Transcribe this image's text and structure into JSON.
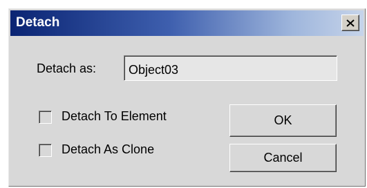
{
  "dialog": {
    "title": "Detach",
    "close_icon": "close-icon"
  },
  "form": {
    "detach_as_label": "Detach as:",
    "detach_as_value": "Object03"
  },
  "options": {
    "detach_to_element_label": "Detach To Element",
    "detach_to_element_checked": false,
    "detach_as_clone_label": "Detach As Clone",
    "detach_as_clone_checked": false
  },
  "buttons": {
    "ok_label": "OK",
    "cancel_label": "Cancel"
  },
  "colors": {
    "title_bar_start": "#0a2473",
    "title_bar_end": "#c6d4ea",
    "dialog_bg": "#d8d8d8"
  }
}
